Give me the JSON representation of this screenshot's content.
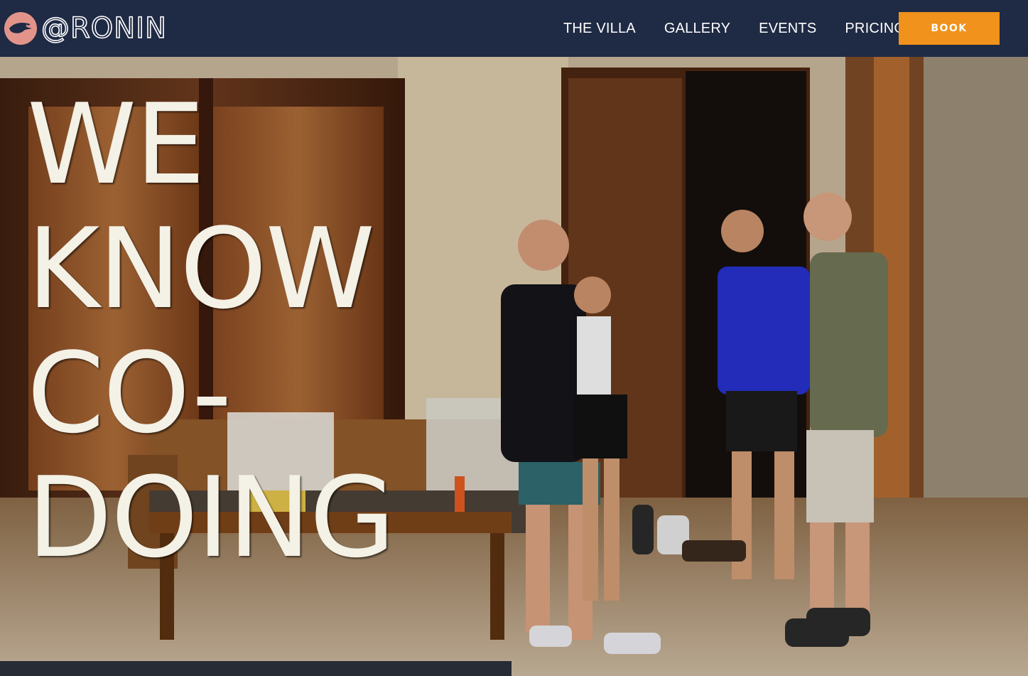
{
  "brand": {
    "logo_icon": "bird-icon",
    "name": "@RONIN",
    "logo_bg_color": "#e2948a"
  },
  "nav": {
    "items": [
      {
        "label": "THE VILLA"
      },
      {
        "label": "GALLERY"
      },
      {
        "label": "EVENTS"
      },
      {
        "label": "PRICING"
      }
    ],
    "book_label": "BOOK",
    "book_color": "#f0921c",
    "bg_color": "#1f2a44"
  },
  "hero": {
    "headline_lines": [
      "WE",
      "KNOW",
      "CO-",
      "DOING"
    ]
  }
}
